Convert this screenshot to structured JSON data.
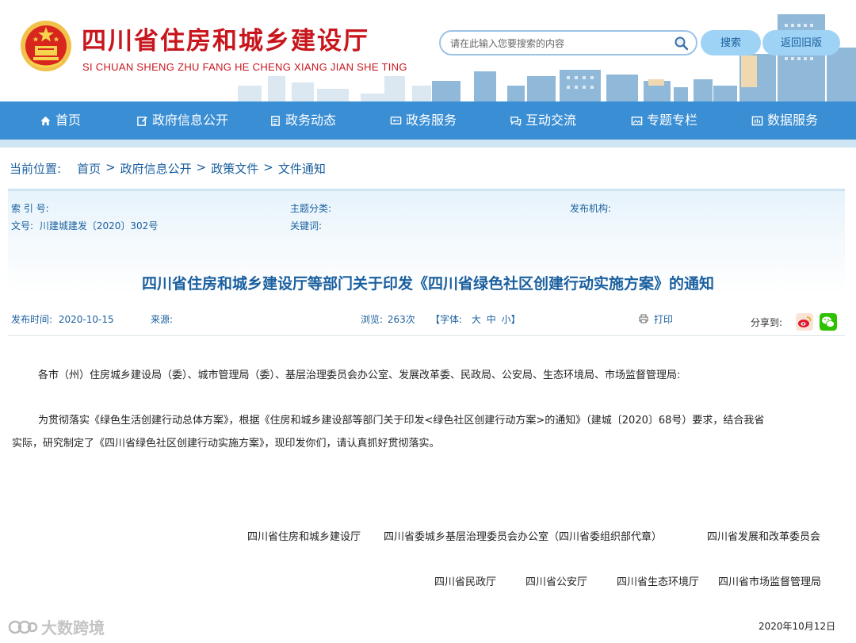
{
  "header": {
    "title": "四川省住房和城乡建设厅",
    "subtitle": "SI CHUAN SHENG ZHU FANG HE CHENG XIANG JIAN SHE TING",
    "search_placeholder": "请在此输入您要搜索的内容",
    "search_button": "搜索",
    "old_version_button": "返回旧版"
  },
  "nav": {
    "items": [
      {
        "label": "首页",
        "icon": "home-icon"
      },
      {
        "label": "政府信息公开",
        "icon": "edit-icon"
      },
      {
        "label": "政务动态",
        "icon": "document-icon"
      },
      {
        "label": "政务服务",
        "icon": "monitor-icon"
      },
      {
        "label": "互动交流",
        "icon": "chat-icon"
      },
      {
        "label": "专题专栏",
        "icon": "image-icon"
      },
      {
        "label": "数据服务",
        "icon": "data-icon"
      }
    ]
  },
  "breadcrumb": {
    "label": "当前位置:",
    "items": [
      "首页",
      "政府信息公开",
      "政策文件",
      "文件通知"
    ],
    "separator": ">"
  },
  "meta": {
    "index_label": "索 引 号:",
    "topic_label": "主题分类:",
    "publisher_label": "发布机构:",
    "doc_no_label": "文号:",
    "doc_no_value": "川建城建发〔2020〕302号",
    "keywords_label": "关键词:"
  },
  "article": {
    "title": "四川省住房和城乡建设厅等部门关于印发《四川省绿色社区创建行动实施方案》的通知",
    "publish_time_label": "发布时间:",
    "publish_time": "2020-10-15",
    "source_label": "来源:",
    "views_label": "浏览:",
    "views": "263次",
    "font_label": "【字体:",
    "font_large": "大",
    "font_medium": "中",
    "font_small": "小】",
    "print_label": "打印",
    "share_label": "分享到:",
    "salutation": "各市（州）住房城乡建设局（委）、城市管理局（委）、基层治理委员会办公室、发展改革委、民政局、公安局、生态环境局、市场监督管理局:",
    "body_line1": "为贯彻落实《绿色生活创建行动总体方案》，根据《住房和城乡建设部等部门关于印发<绿色社区创建行动方案>的通知》（建城〔2020〕68号）要求，结合我省",
    "body_line2": "实际，研究制定了《四川省绿色社区创建行动实施方案》，现印发你们，请认真抓好贯彻落实。",
    "signers_row1": [
      "四川省住房和城乡建设厅",
      "四川省委城乡基层治理委员会办公室（四川省委组织部代章）",
      "四川省发展和改革委员会"
    ],
    "signers_row2": [
      "四川省民政厅",
      "四川省公安厅",
      "四川省生态环境厅",
      "四川省市场监督管理局"
    ],
    "date": "2020年10月12日"
  },
  "watermark": "大数跨境",
  "colors": {
    "brand_red": "#c8161d",
    "nav_blue": "#3a8ed4",
    "link_blue": "#1a5f9e"
  }
}
